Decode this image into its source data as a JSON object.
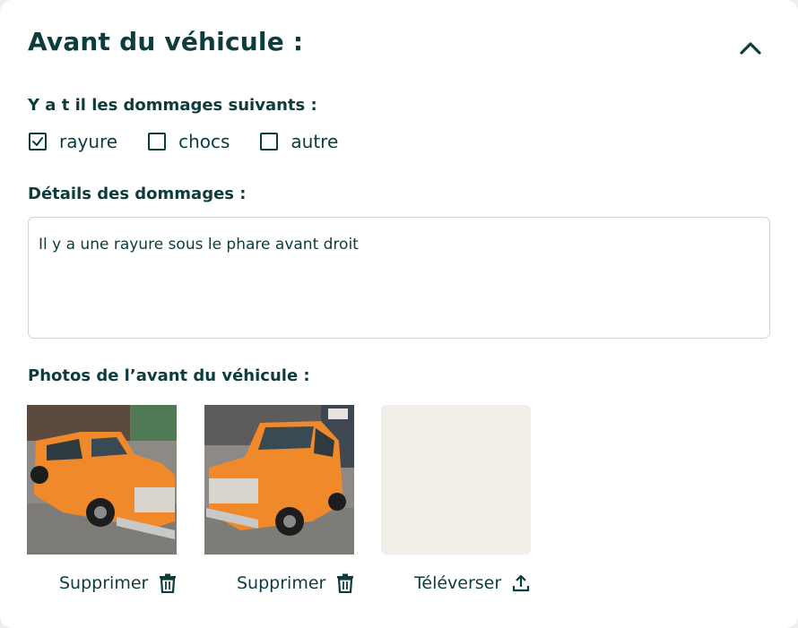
{
  "section": {
    "title": "Avant du véhicule :",
    "collapse_icon": "chevron-up-icon"
  },
  "damages": {
    "label": "Y a t il les dommages suivants :",
    "options": [
      {
        "label": "rayure",
        "checked": true
      },
      {
        "label": "chocs",
        "checked": false
      },
      {
        "label": "autre",
        "checked": false
      }
    ]
  },
  "details": {
    "label": "Détails des dommages :",
    "value": "Il y a une rayure sous le phare avant droit"
  },
  "photos": {
    "label": "Photos de l’avant du véhicule :",
    "items": [
      {
        "action_label": "Supprimer",
        "action_icon": "trash-icon"
      },
      {
        "action_label": "Supprimer",
        "action_icon": "trash-icon"
      }
    ],
    "upload": {
      "action_label": "Téléverser",
      "action_icon": "upload-icon"
    }
  },
  "colors": {
    "text": "#0c3c3c",
    "car": "#f0892a",
    "upload_bg": "#f2efe9"
  }
}
